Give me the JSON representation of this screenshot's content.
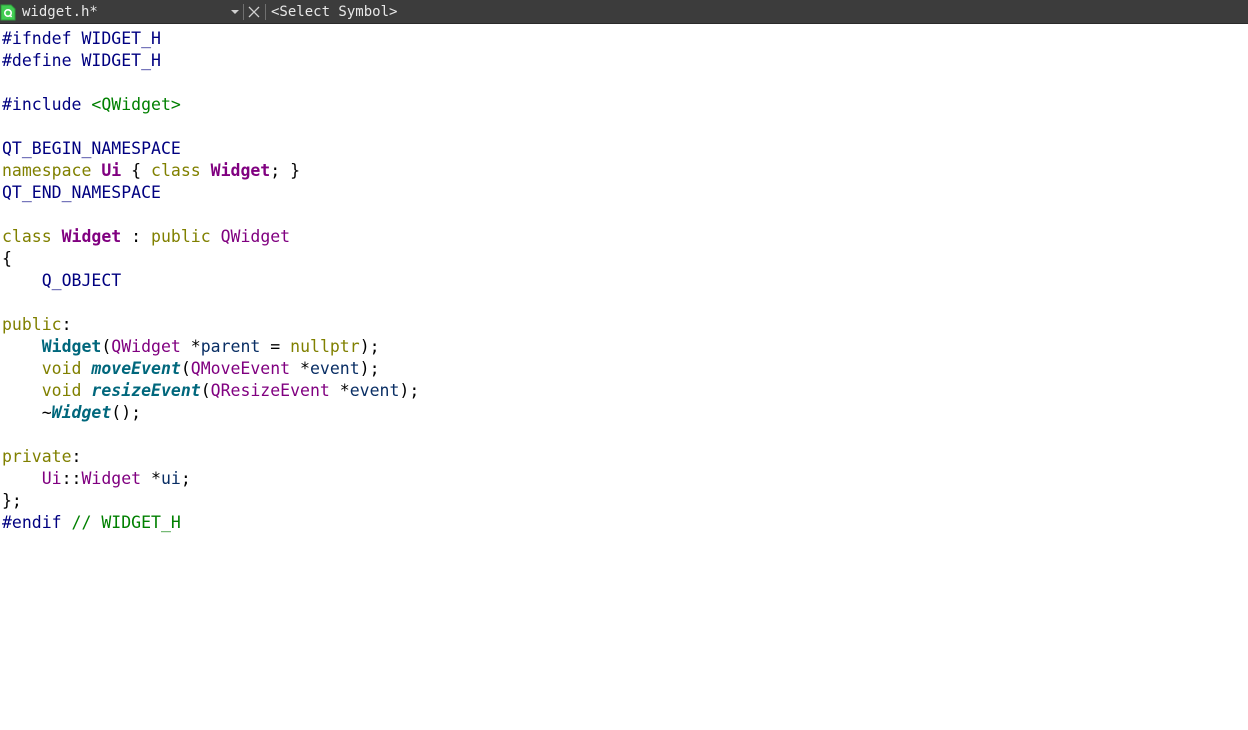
{
  "tab": {
    "file_name": "widget.h*",
    "symbol_placeholder": "<Select Symbol>"
  },
  "icons": {
    "file": "qt-file-icon",
    "dropdown": "chevron-down-icon",
    "close": "close-icon"
  },
  "colors": {
    "toolbar_bg": "#3c3c3c",
    "preprocessor": "#000080",
    "include_path": "#008000",
    "keyword": "#808000",
    "class_name": "#800080",
    "function": "#00677c",
    "comment": "#008000"
  },
  "code": [
    [
      {
        "t": "#ifndef WIDGET_H",
        "c": "pp"
      }
    ],
    [
      {
        "t": "#define WIDGET_H",
        "c": "pp"
      }
    ],
    [],
    [
      {
        "t": "#include ",
        "c": "pp"
      },
      {
        "t": "<QWidget>",
        "c": "inc"
      }
    ],
    [],
    [
      {
        "t": "QT_BEGIN_NAMESPACE",
        "c": "pp"
      }
    ],
    [
      {
        "t": "namespace ",
        "c": "kw"
      },
      {
        "t": "Ui",
        "c": "cls"
      },
      {
        "t": " { ",
        "c": "p"
      },
      {
        "t": "class ",
        "c": "kw"
      },
      {
        "t": "Widget",
        "c": "cls"
      },
      {
        "t": "; }",
        "c": "p"
      }
    ],
    [
      {
        "t": "QT_END_NAMESPACE",
        "c": "pp"
      }
    ],
    [],
    [
      {
        "t": "class ",
        "c": "kw"
      },
      {
        "t": "Widget",
        "c": "cls"
      },
      {
        "t": " : ",
        "c": "p"
      },
      {
        "t": "public ",
        "c": "kw"
      },
      {
        "t": "QWidget",
        "c": "type"
      }
    ],
    [
      {
        "t": "{",
        "c": "p"
      }
    ],
    [
      {
        "t": "    ",
        "c": "p"
      },
      {
        "t": "Q_OBJECT",
        "c": "pp"
      }
    ],
    [],
    [
      {
        "t": "public",
        "c": "kw"
      },
      {
        "t": ":",
        "c": "p"
      }
    ],
    [
      {
        "t": "    ",
        "c": "p"
      },
      {
        "t": "Widget",
        "c": "fnc"
      },
      {
        "t": "(",
        "c": "p"
      },
      {
        "t": "QWidget",
        "c": "type"
      },
      {
        "t": " *",
        "c": "p"
      },
      {
        "t": "parent",
        "c": "id"
      },
      {
        "t": " = ",
        "c": "p"
      },
      {
        "t": "nullptr",
        "c": "kw"
      },
      {
        "t": ");",
        "c": "p"
      }
    ],
    [
      {
        "t": "    ",
        "c": "p"
      },
      {
        "t": "void ",
        "c": "kw"
      },
      {
        "t": "moveEvent",
        "c": "fn"
      },
      {
        "t": "(",
        "c": "p"
      },
      {
        "t": "QMoveEvent",
        "c": "type"
      },
      {
        "t": " *",
        "c": "p"
      },
      {
        "t": "event",
        "c": "id"
      },
      {
        "t": ");",
        "c": "p"
      }
    ],
    [
      {
        "t": "    ",
        "c": "p"
      },
      {
        "t": "void ",
        "c": "kw"
      },
      {
        "t": "resizeEvent",
        "c": "fn"
      },
      {
        "t": "(",
        "c": "p"
      },
      {
        "t": "QResizeEvent",
        "c": "type"
      },
      {
        "t": " *",
        "c": "p"
      },
      {
        "t": "event",
        "c": "id"
      },
      {
        "t": ");",
        "c": "p"
      }
    ],
    [
      {
        "t": "    ~",
        "c": "p"
      },
      {
        "t": "Widget",
        "c": "fn"
      },
      {
        "t": "();",
        "c": "p"
      }
    ],
    [],
    [
      {
        "t": "private",
        "c": "kw"
      },
      {
        "t": ":",
        "c": "p"
      }
    ],
    [
      {
        "t": "    ",
        "c": "p"
      },
      {
        "t": "Ui",
        "c": "type"
      },
      {
        "t": "::",
        "c": "p"
      },
      {
        "t": "Widget",
        "c": "type"
      },
      {
        "t": " *",
        "c": "p"
      },
      {
        "t": "ui",
        "c": "id"
      },
      {
        "t": ";",
        "c": "p"
      }
    ],
    [
      {
        "t": "};",
        "c": "p"
      }
    ],
    [
      {
        "t": "#endif ",
        "c": "pp"
      },
      {
        "t": "// WIDGET_H",
        "c": "cm"
      }
    ]
  ]
}
